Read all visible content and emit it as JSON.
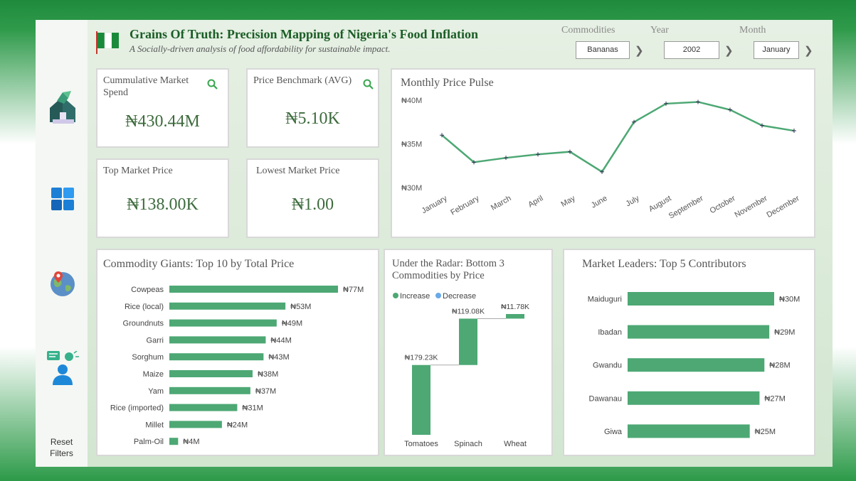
{
  "header": {
    "title": "Grains Of Truth: Precision Mapping of Nigeria's Food Inflation",
    "subtitle": "A Socially-driven analysis of food affordability for sustainable impact."
  },
  "filters": {
    "commodities": {
      "label": "Commodities",
      "value": "Bananas"
    },
    "year": {
      "label": "Year",
      "value": "2002"
    },
    "month": {
      "label": "Month",
      "value": "January"
    }
  },
  "sidebar": {
    "reset_line1": "Reset",
    "reset_line2": "Filters",
    "icons": [
      "home-icon",
      "dashboard-grid-icon",
      "map-pin-globe-icon",
      "insights-person-icon"
    ]
  },
  "kpis": {
    "market_spend": {
      "label": "Cummulative Market Spend",
      "value": "₦430.44M"
    },
    "benchmark": {
      "label": "Price Benchmark (AVG)",
      "value": "₦5.10K"
    },
    "top_price": {
      "label": "Top Market Price",
      "value": "₦138.00K"
    },
    "lowest_price": {
      "label": "Lowest Market Price",
      "value": "₦1.00"
    }
  },
  "colors": {
    "accent": "#4da874",
    "increase": "#4da874",
    "decrease": "#6aa9e8",
    "title_green": "#1a5d25"
  },
  "chart_data": [
    {
      "type": "line",
      "title": "Monthly Price Pulse",
      "x": [
        "January",
        "February",
        "March",
        "April",
        "May",
        "June",
        "July",
        "August",
        "September",
        "October",
        "November",
        "December"
      ],
      "series": [
        {
          "values": [
            36.0,
            32.9,
            33.4,
            33.8,
            34.1,
            31.8,
            37.5,
            39.6,
            39.8,
            38.9,
            37.1,
            36.5
          ]
        }
      ],
      "yticks": [
        "₦30M",
        "₦35M",
        "₦40M"
      ],
      "ylim": [
        30,
        40
      ]
    },
    {
      "type": "bar",
      "title": "Commodity Giants: Top 10 by Total Price",
      "categories": [
        "Cowpeas",
        "Rice (local)",
        "Groundnuts",
        "Garri",
        "Sorghum",
        "Maize",
        "Yam",
        "Rice (imported)",
        "Millet",
        "Palm-Oil"
      ],
      "values": [
        77,
        53,
        49,
        44,
        43,
        38,
        37,
        31,
        24,
        4
      ],
      "labels": [
        "₦77M",
        "₦53M",
        "₦49M",
        "₦44M",
        "₦43M",
        "₦38M",
        "₦37M",
        "₦31M",
        "₦24M",
        "₦4M"
      ]
    },
    {
      "type": "bar",
      "title": "Under the Radar: Bottom 3 Commodities by Price",
      "subtype": "waterfall",
      "legend": [
        "Increase",
        "Decrease"
      ],
      "categories": [
        "Tomatoes",
        "Spinach",
        "Wheat"
      ],
      "values": [
        179.23,
        119.08,
        11.78
      ],
      "labels": [
        "₦179.23K",
        "₦119.08K",
        "₦11.78K"
      ]
    },
    {
      "type": "bar",
      "title": "Market Leaders: Top 5 Contributors",
      "categories": [
        "Maiduguri",
        "Ibadan",
        "Gwandu",
        "Dawanau",
        "Giwa"
      ],
      "values": [
        30,
        29,
        28,
        27,
        25
      ],
      "labels": [
        "₦30M",
        "₦29M",
        "₦28M",
        "₦27M",
        "₦25M"
      ]
    }
  ]
}
